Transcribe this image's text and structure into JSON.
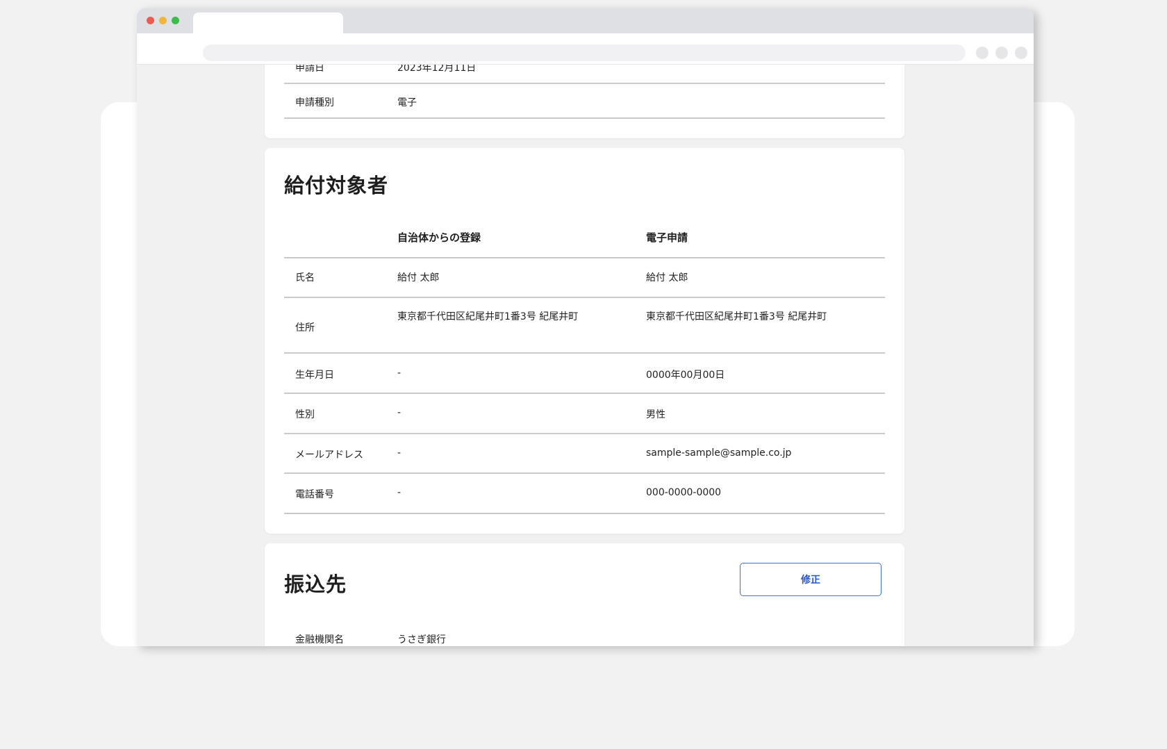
{
  "application_info": {
    "date_label": "申請日",
    "date_value": "2023年12月11日",
    "type_label": "申請種別",
    "type_value": "電子"
  },
  "beneficiary": {
    "title": "給付対象者",
    "columns": [
      "自治体からの登録",
      "電子申請"
    ],
    "rows": [
      {
        "label": "氏名",
        "municipal": "給付 太郎",
        "electronic": "給付 太郎"
      },
      {
        "label": "住所",
        "municipal": "東京都千代田区紀尾井町1番3号 紀尾井町",
        "electronic": "東京都千代田区紀尾井町1番3号 紀尾井町"
      },
      {
        "label": "生年月日",
        "municipal": "-",
        "electronic": "0000年00月00日"
      },
      {
        "label": "性別",
        "municipal": "-",
        "electronic": "男性"
      },
      {
        "label": "メールアドレス",
        "municipal": "-",
        "electronic": "sample-sample@sample.co.jp"
      },
      {
        "label": "電話番号",
        "municipal": "-",
        "electronic": "000-0000-0000"
      }
    ]
  },
  "transfer": {
    "title": "振込先",
    "edit_label": "修正",
    "bank_label": "金融機関名",
    "bank_value": "うさぎ銀行"
  }
}
